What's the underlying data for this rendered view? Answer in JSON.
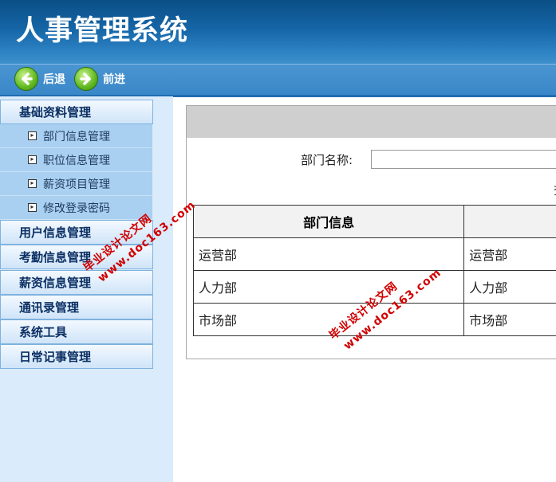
{
  "app": {
    "title": "人事管理系统"
  },
  "toolbar": {
    "back_label": "后退",
    "forward_label": "前进"
  },
  "sidebar": {
    "groups": [
      {
        "label": "基础资料管理",
        "items": [
          "部门信息管理",
          "职位信息管理",
          "薪资项目管理",
          "修改登录密码"
        ]
      },
      {
        "label": "用户信息管理"
      },
      {
        "label": "考勤信息管理"
      },
      {
        "label": "薪资信息管理"
      },
      {
        "label": "通讯录管理"
      },
      {
        "label": "系统工具"
      },
      {
        "label": "日常记事管理"
      }
    ]
  },
  "main": {
    "search_label": "部门名称:",
    "search_value": "",
    "search_button_partial": "查",
    "table": {
      "headers": [
        "部门信息",
        ""
      ],
      "rows": [
        [
          "运营部",
          "运营部"
        ],
        [
          "人力部",
          "人力部"
        ],
        [
          "市场部",
          "市场部"
        ]
      ]
    }
  },
  "watermark": {
    "line1": "毕业设计论文网",
    "line2": "www.doc163.com"
  },
  "colors": {
    "header": "#1565a6",
    "toolbar": "#3a87c8",
    "sidebar_bg": "#daebfb",
    "submenu_bg": "#a9d0f0",
    "watermark": "#d10000"
  }
}
